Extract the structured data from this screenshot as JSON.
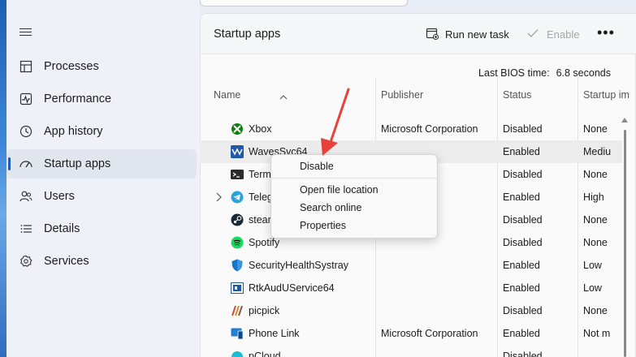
{
  "nav": {
    "items": [
      {
        "label": "Processes",
        "icon": "processes-icon"
      },
      {
        "label": "Performance",
        "icon": "performance-icon"
      },
      {
        "label": "App history",
        "icon": "app-history-icon"
      },
      {
        "label": "Startup apps",
        "icon": "startup-apps-icon",
        "active": true
      },
      {
        "label": "Users",
        "icon": "users-icon"
      },
      {
        "label": "Details",
        "icon": "details-icon"
      },
      {
        "label": "Services",
        "icon": "services-icon"
      }
    ]
  },
  "header": {
    "title": "Startup apps",
    "run_new_task": "Run new task",
    "enable": "Enable",
    "more": "•••"
  },
  "bios": {
    "label": "Last BIOS time:",
    "value": "6.8 seconds"
  },
  "table": {
    "columns": [
      "Name",
      "Publisher",
      "Status",
      "Startup im"
    ],
    "rows": [
      {
        "name": "Xbox",
        "publisher": "Microsoft Corporation",
        "status": "Disabled",
        "impact": "None",
        "icon": "xbox-icon"
      },
      {
        "name": "WavesSvc64",
        "publisher": "",
        "status": "Enabled",
        "impact": "Mediu",
        "icon": "waves-icon",
        "selected": true
      },
      {
        "name": "Term",
        "publisher": "orporation",
        "status": "Disabled",
        "impact": "None",
        "icon": "terminal-icon"
      },
      {
        "name": "Teleg",
        "publisher": "",
        "status": "Enabled",
        "impact": "High",
        "icon": "telegram-icon",
        "expandable": true
      },
      {
        "name": "stear",
        "publisher": "",
        "status": "Disabled",
        "impact": "None",
        "icon": "steam-icon"
      },
      {
        "name": "Spotify",
        "publisher": "",
        "status": "Disabled",
        "impact": "None",
        "icon": "spotify-icon"
      },
      {
        "name": "SecurityHealthSystray",
        "publisher": "",
        "status": "Enabled",
        "impact": "Low",
        "icon": "security-shield-icon"
      },
      {
        "name": "RtkAudUService64",
        "publisher": "",
        "status": "Enabled",
        "impact": "Low",
        "icon": "realtek-icon"
      },
      {
        "name": "picpick",
        "publisher": "",
        "status": "Disabled",
        "impact": "None",
        "icon": "picpick-icon"
      },
      {
        "name": "Phone Link",
        "publisher": "Microsoft Corporation",
        "status": "Enabled",
        "impact": "Not m",
        "icon": "phone-link-icon"
      },
      {
        "name": "pCloud",
        "publisher": "",
        "status": "Disabled",
        "impact": "",
        "icon": "pcloud-icon"
      }
    ]
  },
  "context_menu": {
    "items": [
      "Disable",
      "Open file location",
      "Search online",
      "Properties"
    ]
  },
  "colors": {
    "accent": "#1d5bbf",
    "annotation_arrow": "#e8413c"
  }
}
